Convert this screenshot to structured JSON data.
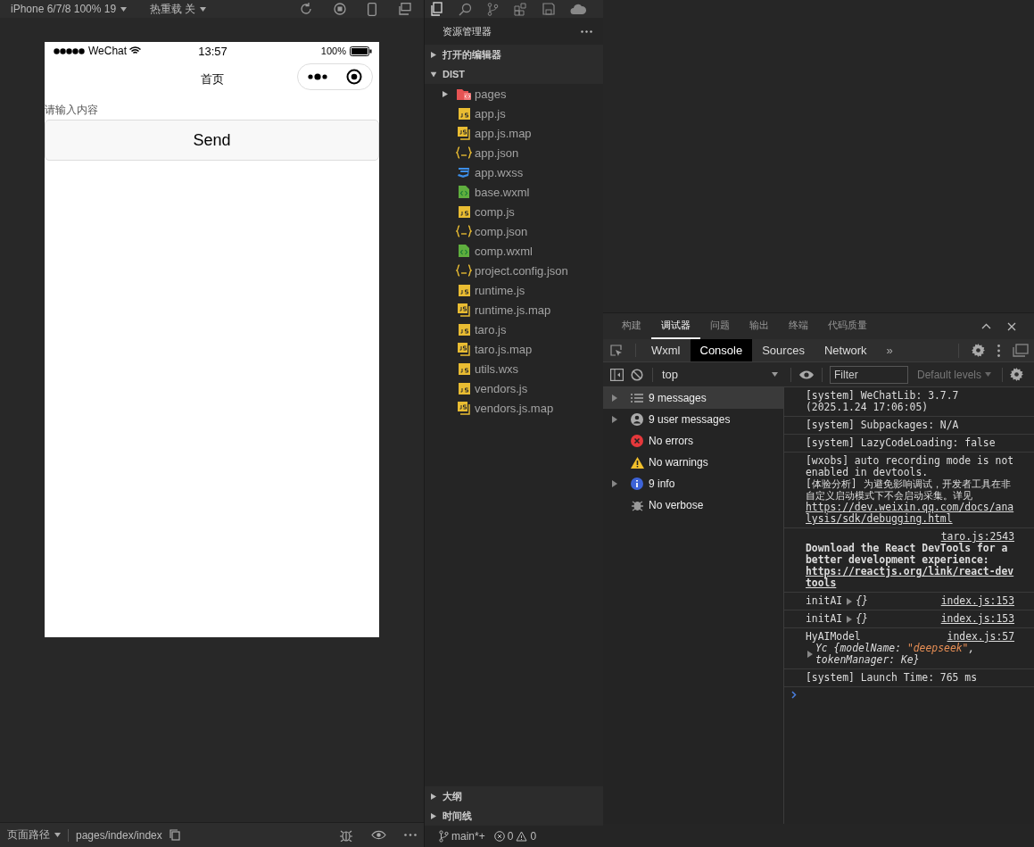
{
  "simulator_toolbar": {
    "device": "iPhone 6/7/8 100% 19",
    "hot_reload": "热重载 关"
  },
  "phone": {
    "status_bar": {
      "carrier": "WeChat",
      "time": "13:57",
      "battery": "100%"
    },
    "nav_title": "首页",
    "input": {
      "placeholder": "请输入内容"
    },
    "button": "Send"
  },
  "simulator_footer": {
    "path_label": "页面路径",
    "path": "pages/index/index"
  },
  "explorer": {
    "title": "资源管理器",
    "sections": [
      {
        "label": "打开的编辑器",
        "expanded": false
      },
      {
        "label": "DIST",
        "expanded": true
      }
    ],
    "files": [
      {
        "name": "pages",
        "kind": "folder",
        "expanded": false
      },
      {
        "name": "app.js",
        "kind": "js"
      },
      {
        "name": "app.js.map",
        "kind": "map"
      },
      {
        "name": "app.json",
        "kind": "json"
      },
      {
        "name": "app.wxss",
        "kind": "css"
      },
      {
        "name": "base.wxml",
        "kind": "wxml"
      },
      {
        "name": "comp.js",
        "kind": "js"
      },
      {
        "name": "comp.json",
        "kind": "json"
      },
      {
        "name": "comp.wxml",
        "kind": "wxml"
      },
      {
        "name": "project.config.json",
        "kind": "json"
      },
      {
        "name": "runtime.js",
        "kind": "js"
      },
      {
        "name": "runtime.js.map",
        "kind": "map"
      },
      {
        "name": "taro.js",
        "kind": "js"
      },
      {
        "name": "taro.js.map",
        "kind": "map"
      },
      {
        "name": "utils.wxs",
        "kind": "js"
      },
      {
        "name": "vendors.js",
        "kind": "js"
      },
      {
        "name": "vendors.js.map",
        "kind": "map"
      }
    ],
    "bottom_sections": [
      {
        "label": "大纲",
        "expanded": false
      },
      {
        "label": "时间线",
        "expanded": false
      }
    ]
  },
  "status_bar": {
    "branch": "main*+",
    "errors": "0",
    "warnings": "0"
  },
  "devtools": {
    "panel_tabs": [
      {
        "label": "构建",
        "selected": false
      },
      {
        "label": "调试器",
        "selected": true
      },
      {
        "label": "问题",
        "selected": false
      },
      {
        "label": "输出",
        "selected": false
      },
      {
        "label": "终端",
        "selected": false
      },
      {
        "label": "代码质量",
        "selected": false
      }
    ],
    "tool_tabs": [
      {
        "label": "Wxml",
        "selected": false
      },
      {
        "label": "Console",
        "selected": true
      },
      {
        "label": "Sources",
        "selected": false
      },
      {
        "label": "Network",
        "selected": false
      }
    ],
    "more": "»",
    "context": "top",
    "filter": {
      "placeholder": "Filter"
    },
    "levels": "Default levels",
    "sidebar": [
      {
        "label": "9 messages",
        "kind": "list",
        "expandable": true,
        "selected": true
      },
      {
        "label": "9 user messages",
        "kind": "user",
        "expandable": true,
        "selected": false
      },
      {
        "label": "No errors",
        "kind": "error",
        "expandable": false,
        "selected": false
      },
      {
        "label": "No warnings",
        "kind": "warning",
        "expandable": false,
        "selected": false
      },
      {
        "label": "9 info",
        "kind": "info",
        "expandable": true,
        "selected": false
      },
      {
        "label": "No verbose",
        "kind": "verbose",
        "expandable": false,
        "selected": false
      }
    ],
    "logs": [
      {
        "kind": "plain",
        "text": "[system] WeChatLib: 3.7.7 (2025.1.24 17:06:05)"
      },
      {
        "kind": "plain",
        "text": "[system] Subpackages: N/A"
      },
      {
        "kind": "plain",
        "text": "[system] LazyCodeLoading: false"
      },
      {
        "kind": "plain",
        "text": "[wxobs] auto recording mode is not enabled in devtools.\n[体验分析] 为避免影响调试，开发者工具在非自定义启动模式下不会启动采集。详见",
        "link": "https://dev.weixin.qq.com/docs/analysis/sdk/debugging.html"
      },
      {
        "kind": "bold",
        "source": "taro.js:2543",
        "text": "Download the React DevTools for a better development experience:",
        "link": "https://reactjs.org/link/react-devtools"
      },
      {
        "kind": "object",
        "label": "initAI",
        "source": "index.js:153",
        "object_on_new_line": false,
        "object": [
          {
            "text": "{}",
            "string": false
          }
        ]
      },
      {
        "kind": "object",
        "label": "initAI",
        "source": "index.js:153",
        "object_on_new_line": false,
        "object": [
          {
            "text": "{}",
            "string": false
          }
        ]
      },
      {
        "kind": "object",
        "label": "HyAIModel",
        "source": "index.js:57",
        "object_on_new_line": true,
        "object": [
          {
            "text": "Yc {modelName: ",
            "string": false
          },
          {
            "text": "\"deepseek\"",
            "string": true
          },
          {
            "text": ", tokenManager: Ke}",
            "string": false
          }
        ]
      },
      {
        "kind": "plain",
        "text": "[system] Launch Time: 765 ms"
      }
    ]
  }
}
